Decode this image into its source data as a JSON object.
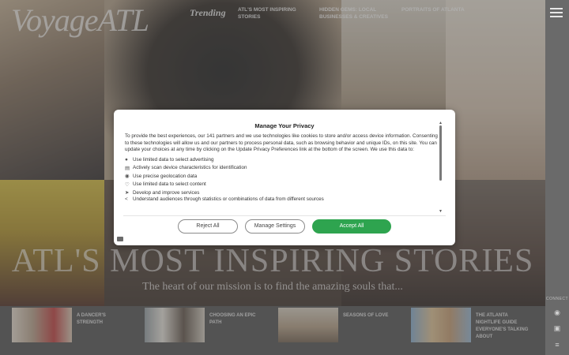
{
  "header": {
    "logo": "VoyageATL",
    "trending": "Trending",
    "nav": [
      {
        "line1": "ATL'S MOST INSPIRING",
        "line2": "STORIES"
      },
      {
        "line1": "HIDDEN GEMS: LOCAL",
        "line2": "BUSINESSES & CREATIVES"
      },
      {
        "line1": "PORTRAITS OF ATLANTA",
        "line2": ""
      }
    ]
  },
  "hero": {
    "title": "ATL'S MOST INSPIRING STORIES",
    "subtitle": "The heart of our mission is to find the amazing souls that..."
  },
  "stories": [
    {
      "line1": "A DANCER'S",
      "line2": "STRENGTH",
      "line3": "",
      "line4": ""
    },
    {
      "line1": "CHOOSING AN EPIC",
      "line2": "PATH",
      "line3": "",
      "line4": ""
    },
    {
      "line1": "SEASONS OF LOVE",
      "line2": "",
      "line3": "",
      "line4": ""
    },
    {
      "line1": "THE ATLANTA",
      "line2": "NIGHTLIFE GUIDE",
      "line3": "EVERYONE'S TALKING",
      "line4": "ABOUT"
    }
  ],
  "sidebar": {
    "connect": "CONNECT"
  },
  "privacy": {
    "title": "Manage Your Privacy",
    "body": "To provide the best experiences, our 141 partners and we use technologies like cookies to store and/or access device information. Consenting to these technologies will allow us and our partners to process personal data, such as browsing behavior and unique IDs, on this site. You can update your choices at any time by clicking on the Update Privacy Preferences link at the bottom of the screen. We use this data to:",
    "purposes": [
      {
        "icon": "user-icon",
        "label": "Use limited data to select advertising"
      },
      {
        "icon": "device-icon",
        "label": "Actively scan device characteristics for identification"
      },
      {
        "icon": "location-pin-icon",
        "label": "Use precise geolocation data"
      },
      {
        "icon": "heart-icon",
        "label": "Use limited data to select content"
      },
      {
        "icon": "rocket-icon",
        "label": "Develop and improve services"
      },
      {
        "icon": "share-icon",
        "label": "Understand audiences through statistics or combinations of data from different sources"
      }
    ],
    "buttons": {
      "reject": "Reject All",
      "manage": "Manage Settings",
      "accept": "Accept All"
    },
    "accept_color": "#2ea44f"
  }
}
